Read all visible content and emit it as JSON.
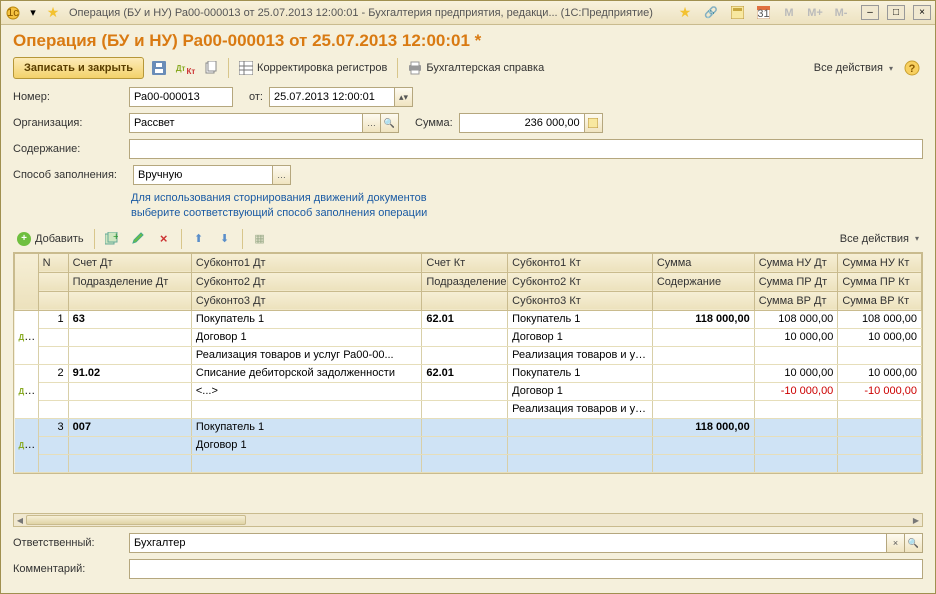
{
  "titlebar": {
    "title": "Операция (БУ и НУ) Ра00-000013 от 25.07.2013 12:00:01 - Бухгалтерия предприятия, редакци... (1С:Предприятие)",
    "mem": [
      "M",
      "M+",
      "M-"
    ]
  },
  "doc_title": "Операция (БУ и НУ) Ра00-000013 от 25.07.2013 12:00:01 *",
  "toolbar": {
    "save_close": "Записать и закрыть",
    "reg_correction": "Корректировка регистров",
    "acc_ref": "Бухгалтерская справка",
    "all_actions": "Все действия"
  },
  "form": {
    "number_label": "Номер:",
    "number_value": "Ра00-000013",
    "from_label": "от:",
    "date_value": "25.07.2013 12:00:01",
    "org_label": "Организация:",
    "org_value": "Рассвет",
    "sum_label": "Сумма:",
    "sum_value": "236 000,00",
    "content_label": "Содержание:",
    "content_value": "",
    "fill_label": "Способ заполнения:",
    "fill_value": "Вручную",
    "hint_l1": "Для использования сторнирования движений документов",
    "hint_l2": "выберите соответствующий способ заполнения операции"
  },
  "grid_toolbar": {
    "add": "Добавить",
    "all_actions": "Все действия"
  },
  "grid": {
    "headers": {
      "n": "N",
      "acc_dt": "Счет Дт",
      "sub1dt": "Субконто1 Дт",
      "acc_kt": "Счет Кт",
      "sub1kt": "Субконто1 Кт",
      "sum": "Сумма",
      "sum_nu_dt": "Сумма НУ Дт",
      "sum_nu_kt": "Сумма НУ Кт",
      "podr_dt": "Подразделение Дт",
      "sub2dt": "Субконто2 Дт",
      "podr_kt": "Подразделение Кт",
      "sub2kt": "Субконто2 Кт",
      "cont": "Содержание",
      "sum_pr_dt": "Сумма ПР Дт",
      "sum_pr_kt": "Сумма ПР Кт",
      "sub3dt": "Субконто3 Дт",
      "sub3kt": "Субконто3 Кт",
      "sum_vr_dt": "Сумма ВР Дт",
      "sum_vr_kt": "Сумма ВР Кт"
    },
    "rows": [
      {
        "n": "1",
        "acc_dt": "63",
        "sub1dt": "Покупатель 1",
        "acc_kt": "62.01",
        "sub1kt": "Покупатель 1",
        "sum": "118 000,00",
        "sum_nu_dt": "108 000,00",
        "sum_nu_kt": "108 000,00",
        "sub2dt": "Договор 1",
        "sub2kt": "Договор 1",
        "sum_pr_dt": "10 000,00",
        "sum_pr_kt": "10 000,00",
        "sub3dt": "Реализация товаров и услуг Ра00-00...",
        "sub3kt": "Реализация товаров и услуг..."
      },
      {
        "n": "2",
        "acc_dt": "91.02",
        "sub1dt": "Списание дебиторской задолженности",
        "acc_kt": "62.01",
        "sub1kt": "Покупатель 1",
        "sum": "",
        "sum_nu_dt": "10 000,00",
        "sum_nu_kt": "10 000,00",
        "sub2dt": "<...>",
        "sub2kt": "Договор 1",
        "sum_pr_dt": "-10 000,00",
        "sum_pr_kt": "-10 000,00",
        "sub3kt": "Реализация товаров и услуг..."
      },
      {
        "n": "3",
        "acc_dt": "007",
        "sub1dt": "Покупатель 1",
        "sum": "118 000,00",
        "sub2dt": "Договор 1"
      }
    ]
  },
  "footer": {
    "resp_label": "Ответственный:",
    "resp_value": "Бухгалтер",
    "comment_label": "Комментарий:",
    "comment_value": ""
  }
}
